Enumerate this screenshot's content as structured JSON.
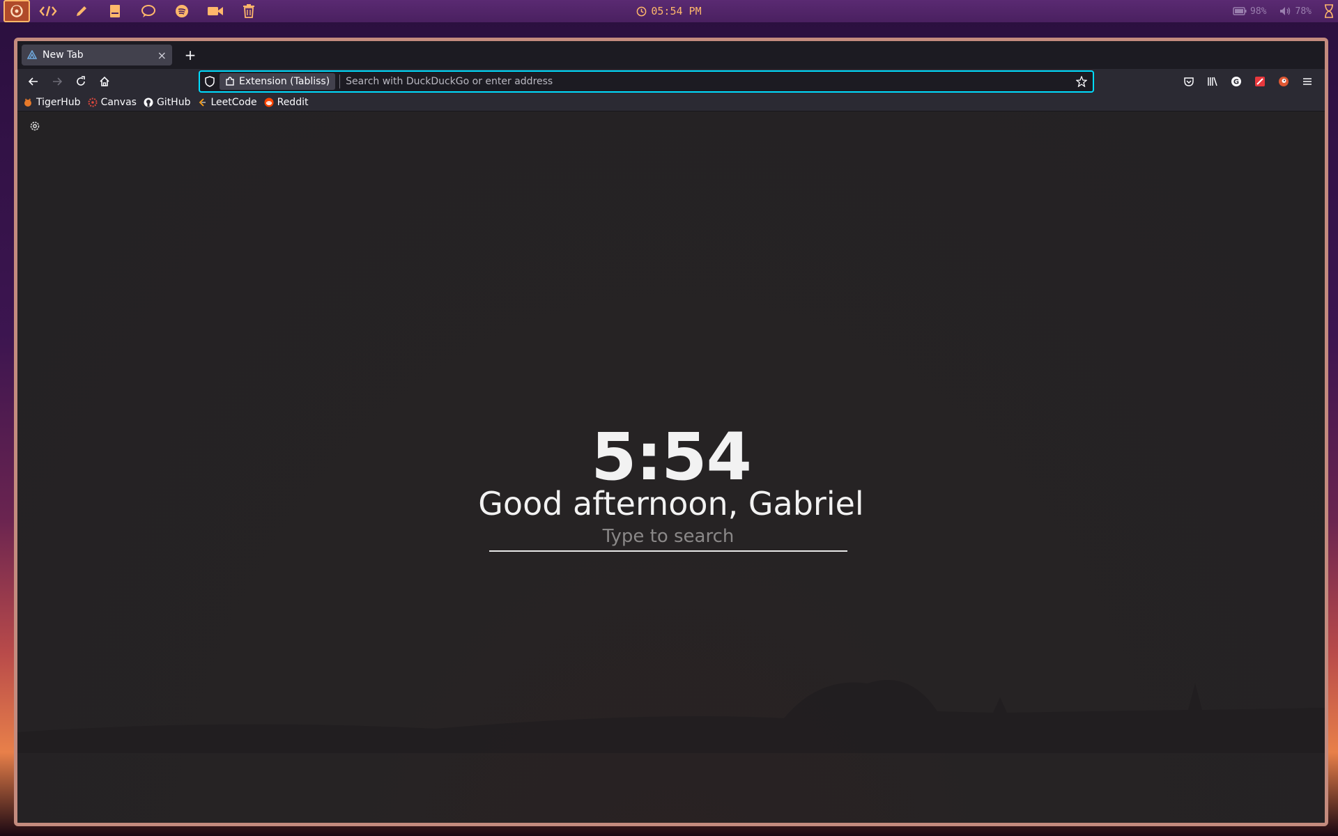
{
  "panel": {
    "launchers": [
      {
        "name": "firefox-launcher",
        "icon": "firefox-icon",
        "active": true
      },
      {
        "name": "code-editor-launcher",
        "icon": "code-icon"
      },
      {
        "name": "pencil-launcher",
        "icon": "pencil-icon"
      },
      {
        "name": "notes-launcher",
        "icon": "book-icon"
      },
      {
        "name": "chat-launcher",
        "icon": "chat-bubble-icon"
      },
      {
        "name": "spotify-launcher",
        "icon": "spotify-icon"
      },
      {
        "name": "video-launcher",
        "icon": "video-camera-icon"
      },
      {
        "name": "trash-launcher",
        "icon": "trash-icon"
      }
    ],
    "clock": "05:54 PM",
    "battery": "98%",
    "volume": "78%",
    "accent_color": "#ffb86b"
  },
  "browser": {
    "tab": {
      "title": "New Tab",
      "close": "×"
    },
    "new_tab": "+",
    "urlbar": {
      "extension_label": "Extension (Tabliss)",
      "placeholder": "Search with DuckDuckGo or enter address"
    },
    "bookmarks": [
      {
        "label": "TigerHub",
        "icon": "tigerhub-icon"
      },
      {
        "label": "Canvas",
        "icon": "canvas-icon"
      },
      {
        "label": "GitHub",
        "icon": "github-icon"
      },
      {
        "label": "LeetCode",
        "icon": "leetcode-icon"
      },
      {
        "label": "Reddit",
        "icon": "reddit-icon"
      }
    ]
  },
  "newtab": {
    "time": "5:54",
    "greeting": "Good afternoon, Gabriel",
    "search_placeholder": "Type to search"
  }
}
